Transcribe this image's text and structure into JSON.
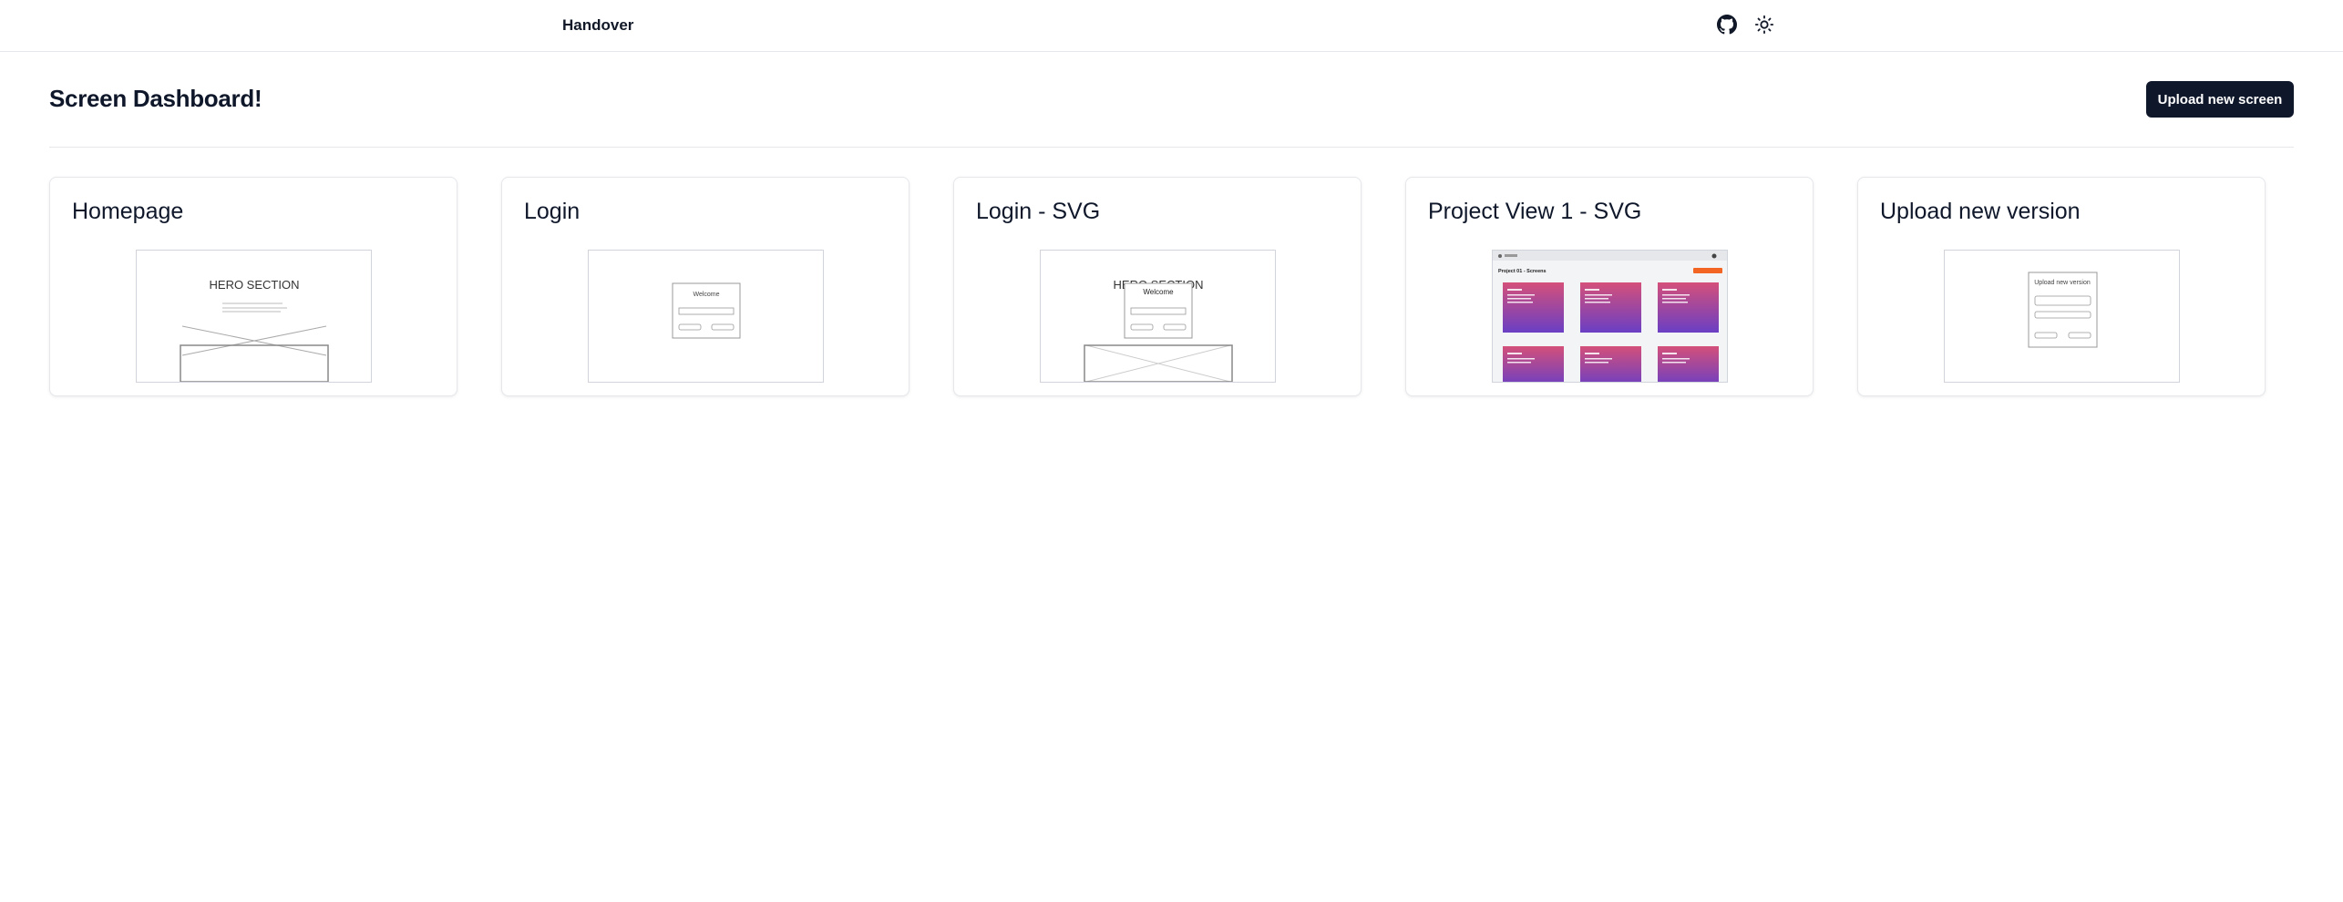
{
  "header": {
    "brand": "Handover",
    "github_icon": "github-icon",
    "theme_icon": "sun-icon"
  },
  "page": {
    "title": "Screen Dashboard!",
    "upload_button": "Upload new screen"
  },
  "screens": [
    {
      "title": "Homepage",
      "preview": "wireframe-hero",
      "preview_text": "HERO SECTION"
    },
    {
      "title": "Login",
      "preview": "wireframe-login",
      "preview_text": "Welcome"
    },
    {
      "title": "Login - SVG",
      "preview": "wireframe-login-over-hero",
      "preview_text": "Welcome"
    },
    {
      "title": "Project View 1 - SVG",
      "preview": "project-view",
      "preview_text": "Project 01 - Screens"
    },
    {
      "title": "Upload new version",
      "preview": "wireframe-upload",
      "preview_text": "Upload new version"
    }
  ],
  "colors": {
    "primary": "#0f172a",
    "card_gradient_top": "#d4507a",
    "card_gradient_bottom": "#6a3fc4",
    "accent_orange": "#f26522"
  }
}
